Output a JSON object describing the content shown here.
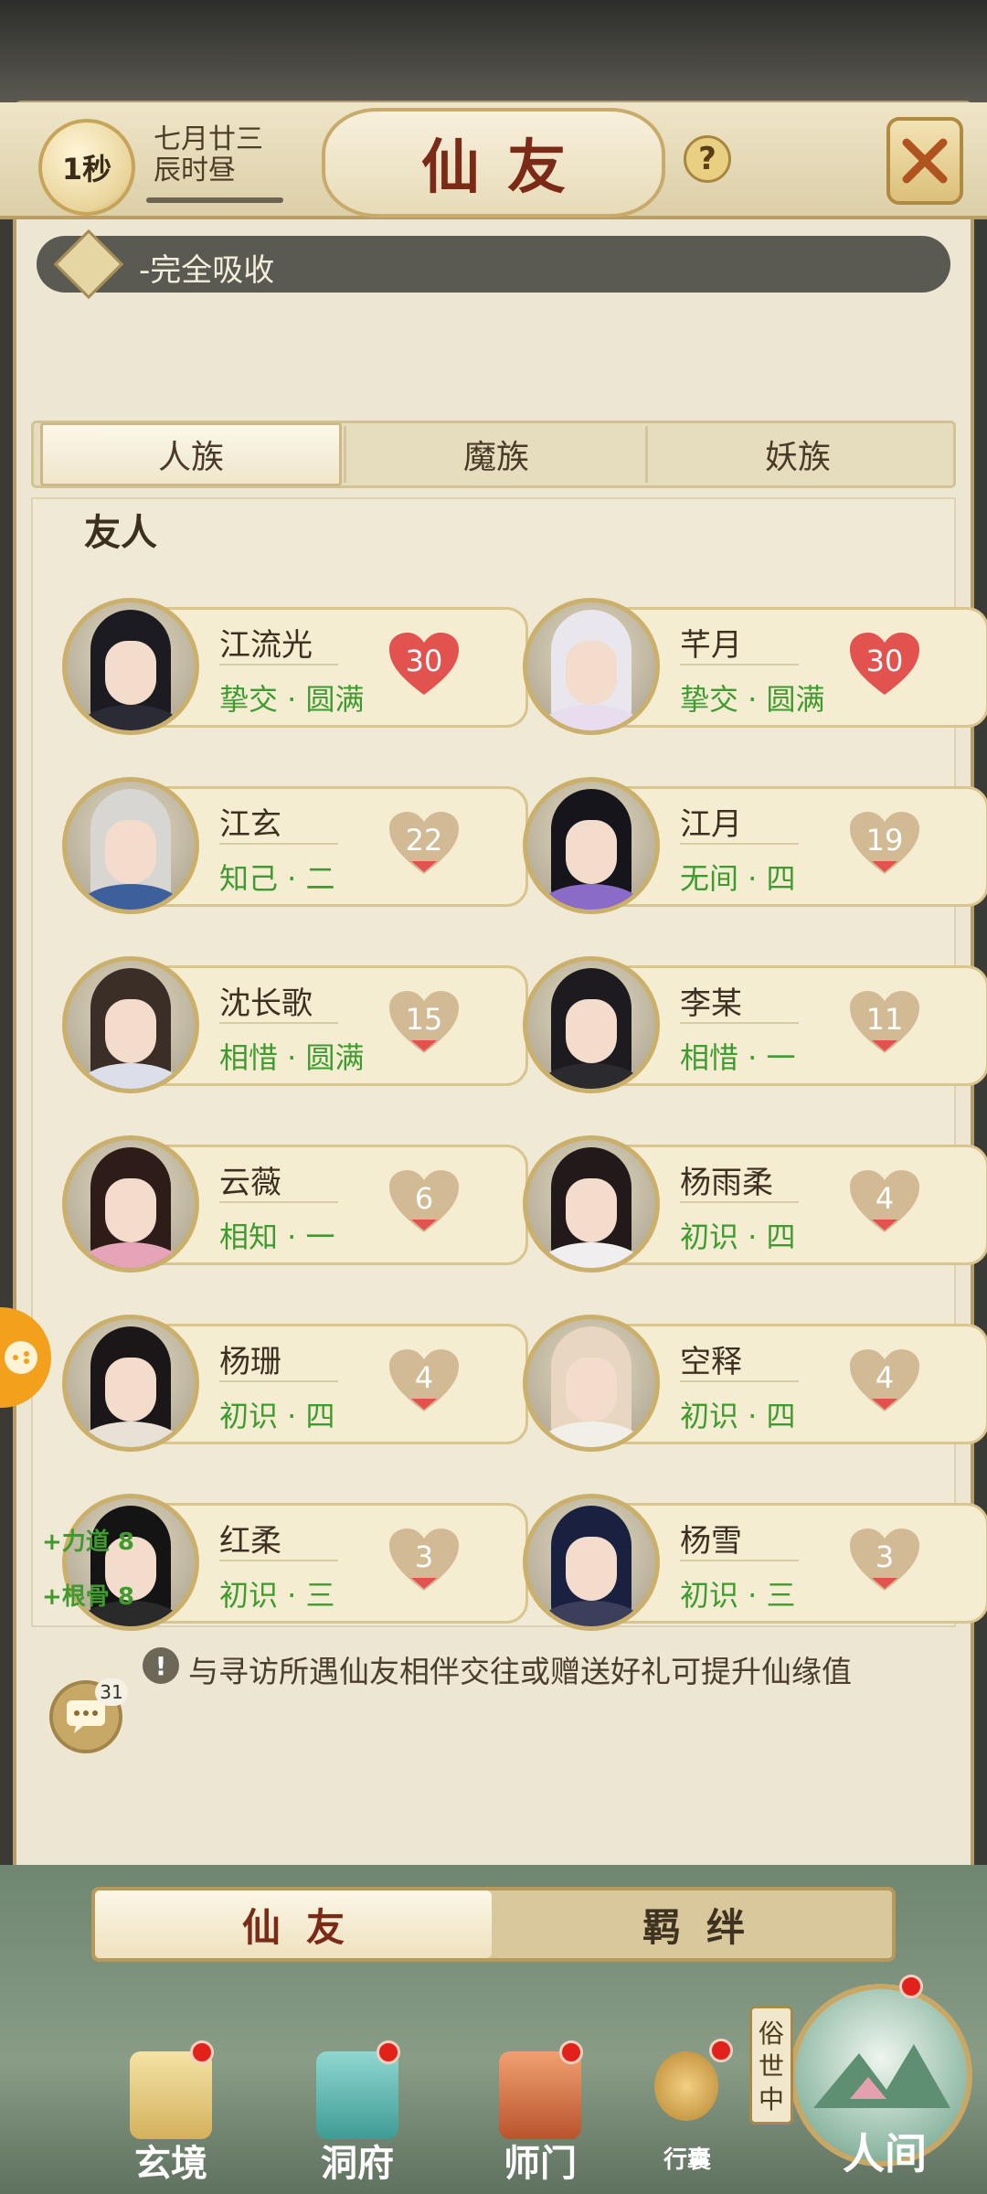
{
  "header": {
    "timer": "1秒",
    "date_line1": "七月廿三",
    "date_line2": "辰时昼",
    "title": "仙友",
    "help_icon": "question-icon",
    "close_icon": "close-x-icon"
  },
  "notice": {
    "icon": "bell-icon",
    "text": "-完全吸收"
  },
  "race_tabs": [
    "人族",
    "魔族",
    "妖族"
  ],
  "race_tab_active": "人族",
  "friends": {
    "title": "友人",
    "items": [
      {
        "name": "江流光",
        "relation": "挚交 · 圆满",
        "affinity": "30",
        "heart_full": true
      },
      {
        "name": "芊月",
        "relation": "挚交 · 圆满",
        "affinity": "30",
        "heart_full": true
      },
      {
        "name": "江玄",
        "relation": "知己 · 二",
        "affinity": "22",
        "heart_full": false
      },
      {
        "name": "江月",
        "relation": "无间 · 四",
        "affinity": "19",
        "heart_full": false
      },
      {
        "name": "沈长歌",
        "relation": "相惜 · 圆满",
        "affinity": "15",
        "heart_full": false
      },
      {
        "name": "李某",
        "relation": "相惜 · 一",
        "affinity": "11",
        "heart_full": false
      },
      {
        "name": "云薇",
        "relation": "相知 · 一",
        "affinity": "6",
        "heart_full": false
      },
      {
        "name": "杨雨柔",
        "relation": "初识 · 四",
        "affinity": "4",
        "heart_full": false
      },
      {
        "name": "杨珊",
        "relation": "初识 · 四",
        "affinity": "4",
        "heart_full": false
      },
      {
        "name": "空释",
        "relation": "初识 · 四",
        "affinity": "4",
        "heart_full": false
      },
      {
        "name": "红柔",
        "relation": "初识 · 三",
        "affinity": "3",
        "heart_full": false
      },
      {
        "name": "杨雪",
        "relation": "初识 · 三",
        "affinity": "3",
        "heart_full": false
      }
    ],
    "buffs": [
      "+力道 8",
      "+根骨 8"
    ]
  },
  "hint": "与寻访所遇仙友相伴交往或赠送好礼可提升仙缘值",
  "chat": {
    "icon": "chat-bubble-icon",
    "count": "31"
  },
  "sub_tabs": [
    "仙友",
    "羁绊"
  ],
  "bottom_nav": [
    {
      "label": "玄境",
      "icon": "scroll-icon"
    },
    {
      "label": "洞府",
      "icon": "pavilion-icon"
    },
    {
      "label": "师门",
      "icon": "banner-icon"
    },
    {
      "label": "行囊",
      "icon": "pouch-icon"
    },
    {
      "label": "人间",
      "icon": "landscape-icon"
    }
  ],
  "world_banner": "俗世中"
}
